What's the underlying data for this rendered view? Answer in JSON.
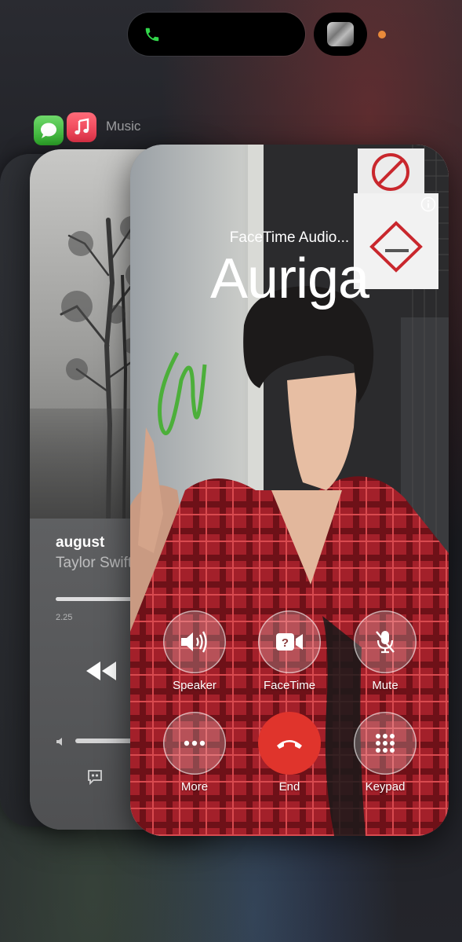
{
  "status_bar": {
    "island_icon": "phone-icon",
    "island_color": "#32d74b",
    "privacy_dot_color": "#e98a3a"
  },
  "app_switcher": {
    "app_label": "Music",
    "icons": [
      "messages-icon",
      "music-icon"
    ]
  },
  "music_card": {
    "song_title": "august",
    "artist": "Taylor Swift",
    "elapsed": "2.25"
  },
  "call_card": {
    "subtitle": "FaceTime Audio...",
    "contact_name": "Auriga",
    "controls": [
      {
        "label": "Speaker",
        "icon": "speaker-icon"
      },
      {
        "label": "FaceTime",
        "icon": "facetime-icon"
      },
      {
        "label": "Mute",
        "icon": "mic-slash-icon"
      },
      {
        "label": "More",
        "icon": "ellipsis-icon"
      },
      {
        "label": "End",
        "icon": "end-call-icon"
      },
      {
        "label": "Keypad",
        "icon": "keypad-icon"
      }
    ],
    "end_color": "#e0342c"
  }
}
